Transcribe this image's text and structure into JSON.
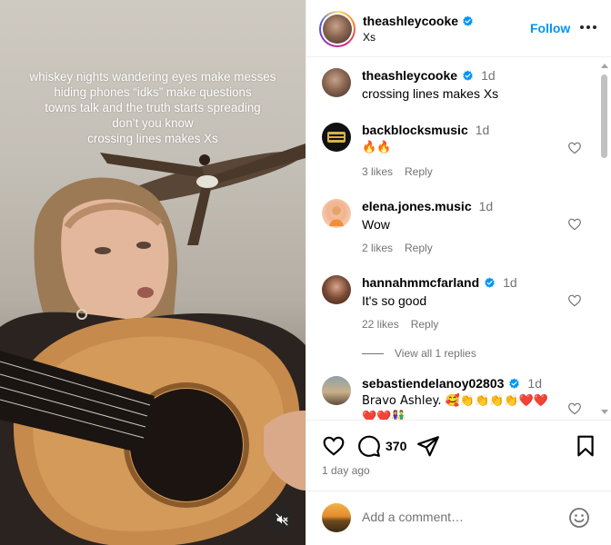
{
  "video": {
    "caption_lines": [
      "whiskey nights wandering eyes make messes",
      "hiding phones “idks” make questions",
      "towns talk and the truth starts spreading",
      "don’t you know",
      "crossing lines makes Xs"
    ],
    "mute_icon": "speaker-muted-icon"
  },
  "header": {
    "username": "theashleycooke",
    "subtitle": "Xs",
    "follow_label": "Follow",
    "more_icon": "more-horizontal-icon"
  },
  "comments": [
    {
      "username": "theashleycooke",
      "verified": true,
      "time": "1d",
      "text": "crossing lines makes Xs",
      "caption": true
    },
    {
      "username": "backblocksmusic",
      "verified": false,
      "time": "1d",
      "text": "🔥🔥",
      "likes": "3 likes",
      "reply": "Reply"
    },
    {
      "username": "elena.jones.music",
      "verified": false,
      "time": "1d",
      "text": "Wow",
      "likes": "2 likes",
      "reply": "Reply"
    },
    {
      "username": "hannahmmcfarland",
      "verified": true,
      "time": "1d",
      "text": "It's so good",
      "likes": "22 likes",
      "reply": "Reply"
    },
    {
      "username": "sebastiendelanoy02803",
      "verified": true,
      "time": "1d",
      "text_line1": "Bravo Ashley. 🥰👏👏👏👏❤️❤️",
      "text_line2": "❤️❤️👫"
    }
  ],
  "view_replies": "View all 1 replies",
  "actions": {
    "like_icon": "heart-icon",
    "comment_icon": "comment-icon",
    "comment_count": "370",
    "share_icon": "share-icon",
    "save_icon": "bookmark-icon",
    "time_ago": "1 day ago"
  },
  "add_comment": {
    "placeholder": "Add a comment…",
    "emoji_icon": "emoji-icon"
  },
  "colors": {
    "accent": "#0095f6",
    "muted_text": "#737373",
    "verified": "#0095f6",
    "divider": "#efefef"
  }
}
